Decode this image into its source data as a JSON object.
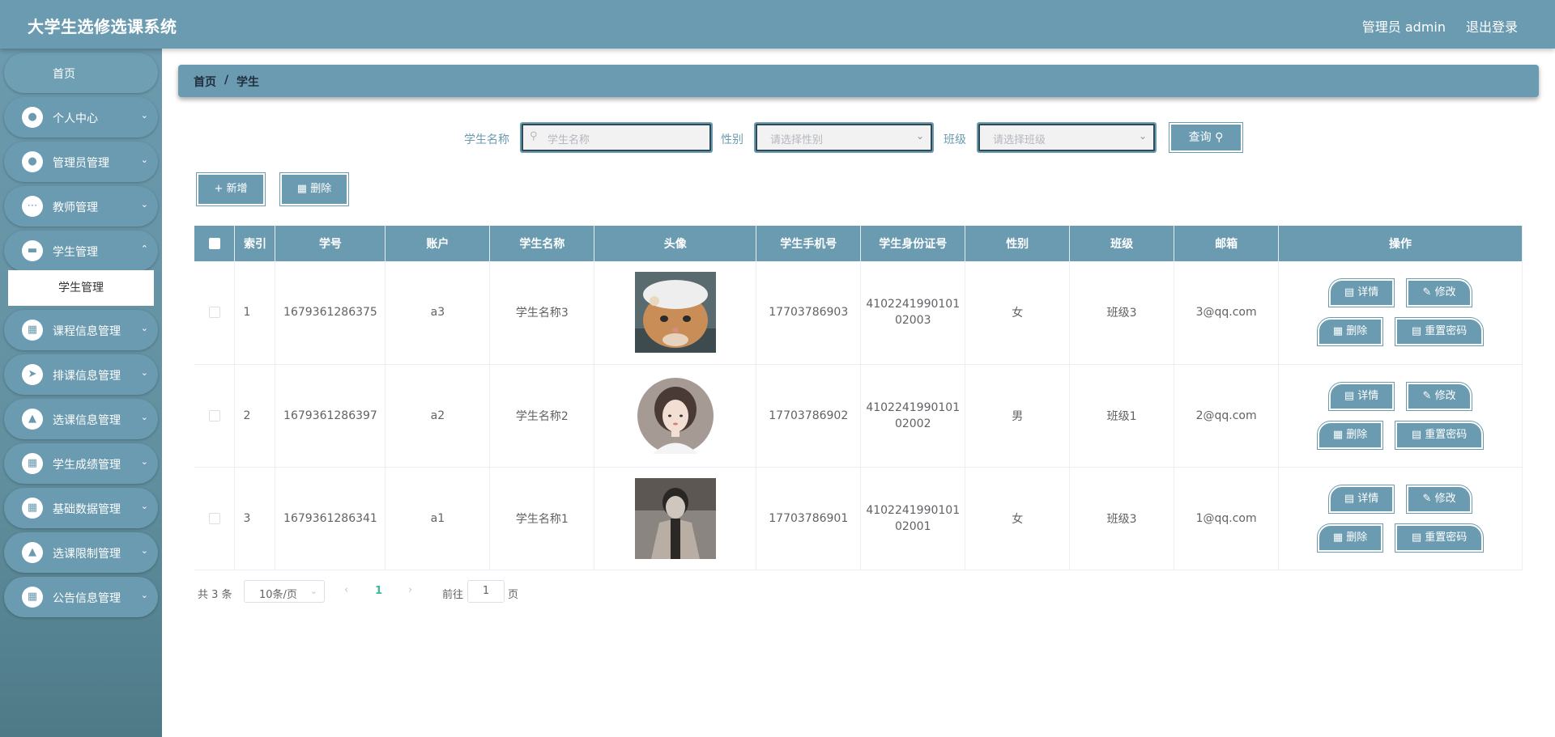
{
  "header": {
    "title": "大学生选修选课系统",
    "user": "管理员 admin",
    "logout": "退出登录"
  },
  "sidebar": {
    "home": "首页",
    "items": [
      {
        "label": "个人中心",
        "icon": "user-icon"
      },
      {
        "label": "管理员管理",
        "icon": "user-icon"
      },
      {
        "label": "教师管理",
        "icon": "chat-icon"
      },
      {
        "label": "学生管理",
        "icon": "ticket-icon"
      },
      {
        "label": "课程信息管理",
        "icon": "grid-icon"
      },
      {
        "label": "排课信息管理",
        "icon": "send-icon"
      },
      {
        "label": "选课信息管理",
        "icon": "thumb-icon"
      },
      {
        "label": "学生成绩管理",
        "icon": "grid-icon"
      },
      {
        "label": "基础数据管理",
        "icon": "grid-icon"
      },
      {
        "label": "选课限制管理",
        "icon": "stamp-icon"
      },
      {
        "label": "公告信息管理",
        "icon": "grid-icon"
      }
    ],
    "active_sub": "学生管理"
  },
  "breadcrumb": {
    "home": "首页",
    "sep": "/",
    "current": "学生"
  },
  "search": {
    "name_label": "学生名称",
    "name_placeholder": "学生名称",
    "gender_label": "性别",
    "gender_placeholder": "请选择性别",
    "class_label": "班级",
    "class_placeholder": "请选择班级",
    "query": "查询"
  },
  "actions": {
    "add": "新增",
    "delete": "删除"
  },
  "table": {
    "columns": [
      "索引",
      "学号",
      "账户",
      "学生名称",
      "头像",
      "学生手机号",
      "学生身份证号",
      "性别",
      "班级",
      "邮箱",
      "操作"
    ],
    "rows": [
      {
        "index": "1",
        "no": "1679361286375",
        "account": "a3",
        "name": "学生名称3",
        "phone": "17703786903",
        "id1": "4102241990101",
        "id2": "02003",
        "gender": "女",
        "class": "班级3",
        "email": "3@qq.com"
      },
      {
        "index": "2",
        "no": "1679361286397",
        "account": "a2",
        "name": "学生名称2",
        "phone": "17703786902",
        "id1": "4102241990101",
        "id2": "02002",
        "gender": "男",
        "class": "班级1",
        "email": "2@qq.com"
      },
      {
        "index": "3",
        "no": "1679361286341",
        "account": "a1",
        "name": "学生名称1",
        "phone": "17703786901",
        "id1": "4102241990101",
        "id2": "02001",
        "gender": "女",
        "class": "班级3",
        "email": "1@qq.com"
      }
    ],
    "ops": {
      "detail": "详情",
      "edit": "修改",
      "delete": "删除",
      "reset": "重置密码"
    }
  },
  "pagination": {
    "total": "共 3 条",
    "page_size": "10条/页",
    "current": "1",
    "goto": "前往",
    "goto_value": "1",
    "page_suffix": "页"
  },
  "colors": {
    "primary": "#6b9bb0",
    "active_page": "#3fb7a0"
  }
}
